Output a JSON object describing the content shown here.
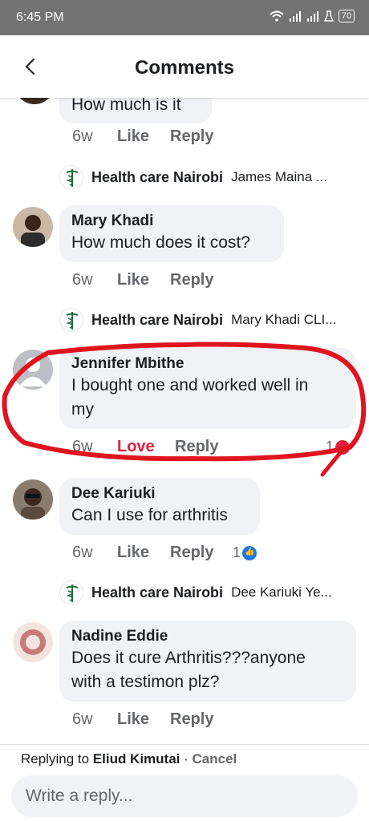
{
  "status_bar": {
    "time": "6:45 PM",
    "battery": "70"
  },
  "header": {
    "title": "Comments"
  },
  "comments": [
    {
      "author": "",
      "text": "How much is it",
      "time": "6w",
      "action": "Like",
      "reply": "Reply"
    },
    {
      "author": "Mary Khadi",
      "text": "How much does it cost?",
      "time": "6w",
      "action": "Like",
      "reply": "Reply"
    },
    {
      "author": "Jennifer Mbithe",
      "text_line1": "I bought one and worked well in",
      "text_line2": "my",
      "time": "6w",
      "action": "Love",
      "reply": "Reply",
      "reaction_count": "1"
    },
    {
      "author": "Dee Kariuki",
      "text": "Can I use for arthritis",
      "time": "6w",
      "action": "Like",
      "reply": "Reply",
      "reaction_count": "1"
    },
    {
      "author": "Nadine Eddie",
      "text_line1": "Does it cure Arthritis???anyone",
      "text_line2": "with a testimon plz?",
      "time": "6w",
      "action": "Like",
      "reply": "Reply"
    }
  ],
  "replies": [
    {
      "page": "Health care Nairobi",
      "snippet": "James Maina ..."
    },
    {
      "page": "Health care Nairobi",
      "snippet": "Mary Khadi CLI..."
    },
    {
      "page": "Health care Nairobi",
      "snippet": "Dee Kariuki Ye..."
    }
  ],
  "footer": {
    "replying_prefix": "Replying to ",
    "replying_name": "Eliud Kimutai",
    "separator": " · ",
    "cancel": "Cancel",
    "placeholder": "Write a reply..."
  },
  "colors": {
    "love": "#e41e3f",
    "like_blue": "#1877f2",
    "bubble": "#f0f2f5",
    "annotation_red": "#e0141e"
  },
  "icons": {
    "back": "chevron-left-icon",
    "wifi": "wifi-icon",
    "signal": "signal-icon",
    "battery": "battery-icon",
    "page_logo": "caduceus-logo-icon"
  }
}
